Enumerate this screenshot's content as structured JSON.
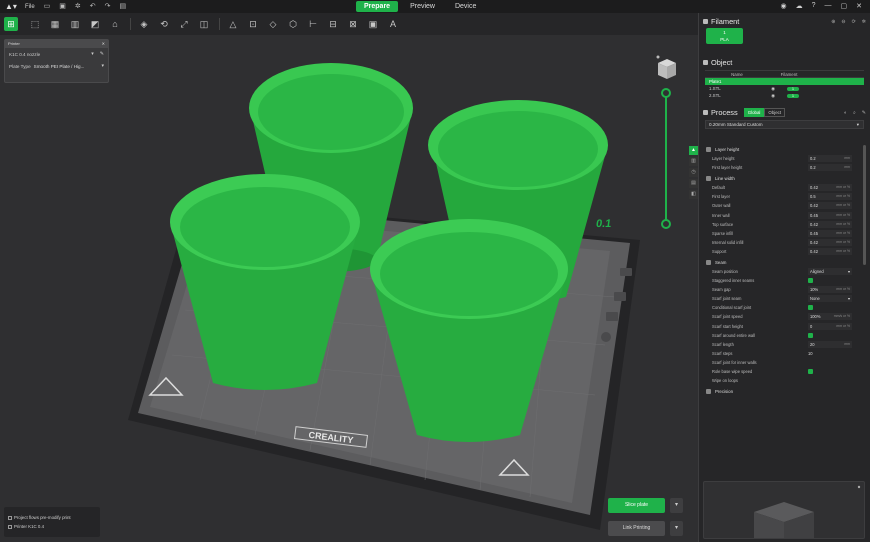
{
  "topbar": {
    "file_label": "File",
    "tabs": [
      "Prepare",
      "Preview",
      "Device"
    ],
    "active_tab": "Prepare",
    "window_controls": [
      "minimize-icon",
      "maximize-icon",
      "close-icon"
    ]
  },
  "toolbar": {
    "icons": [
      "add-plate-icon",
      "add-object-icon",
      "delete-icon",
      "arrange-icon",
      "orient-icon",
      "move-icon",
      "rotate-icon",
      "scale-icon",
      "lay-on-face-icon",
      "cut-icon",
      "mesh-boolean-icon",
      "support-paint-icon",
      "seam-paint-icon",
      "color-paint-icon",
      "measure-icon",
      "assembly-icon",
      "text-icon"
    ]
  },
  "plate_panel": {
    "title": "Printer",
    "printer": "K1C 0.4 nozzle",
    "plate_type_label": "Plate Type",
    "plate_type_value": "Smooth PEI Plate / Hig..."
  },
  "viewport": {
    "layer_value": "0.1",
    "bed_brand": "CREALITY",
    "status": [
      "Project flows pre-modify print",
      "Printer K1C 0.4"
    ],
    "slice_button": "Slice plate",
    "print_button": "Link Printing",
    "colors": {
      "accent": "#1fb24a",
      "model": "#2fc046",
      "bed": "#5a5a5c"
    }
  },
  "filament": {
    "title": "Filament",
    "slot": "1",
    "type": "PLA"
  },
  "object": {
    "title": "Object",
    "col_name": "Name",
    "col_filament": "Filament",
    "rows": [
      {
        "name": "Plate1",
        "selected": true,
        "filament": ""
      },
      {
        "name": "1.STL",
        "selected": false,
        "filament": "1"
      },
      {
        "name": "2.STL",
        "selected": false,
        "filament": "1"
      }
    ]
  },
  "process": {
    "title": "Process",
    "tab_global": "Global",
    "tab_object": "Object",
    "preset": "0.20mm Standard Custom",
    "groups": [
      {
        "name": "Layer height",
        "rows": [
          {
            "label": "Layer height",
            "value": "0.2",
            "unit": "mm"
          },
          {
            "label": "First layer height",
            "value": "0.2",
            "unit": "mm"
          }
        ]
      },
      {
        "name": "Line width",
        "rows": [
          {
            "label": "Default",
            "value": "0.42",
            "unit": "mm or %"
          },
          {
            "label": "First layer",
            "value": "0.5",
            "unit": "mm or %"
          },
          {
            "label": "Outer wall",
            "value": "0.42",
            "unit": "mm or %"
          },
          {
            "label": "Inner wall",
            "value": "0.45",
            "unit": "mm or %"
          },
          {
            "label": "Top surface",
            "value": "0.42",
            "unit": "mm or %"
          },
          {
            "label": "Sparse infill",
            "value": "0.45",
            "unit": "mm or %"
          },
          {
            "label": "Internal solid infill",
            "value": "0.42",
            "unit": "mm or %"
          },
          {
            "label": "Support",
            "value": "0.42",
            "unit": "mm or %"
          }
        ]
      },
      {
        "name": "Seam",
        "rows": [
          {
            "label": "Seam position",
            "kind": "dropdown",
            "value": "Aligned"
          },
          {
            "label": "Staggered inner seams",
            "kind": "check"
          },
          {
            "label": "Seam gap",
            "value": "10%",
            "unit": "mm or %"
          },
          {
            "label": "Scarf joint seam",
            "kind": "dropdown",
            "value": "None"
          },
          {
            "label": "Conditional scarf joint",
            "kind": "check"
          },
          {
            "label": "Scarf joint speed",
            "value": "100%",
            "unit": "mm/s or %"
          },
          {
            "label": "Scarf start height",
            "value": "0",
            "unit": "mm or %"
          },
          {
            "label": "Scarf around entire wall",
            "kind": "check"
          },
          {
            "label": "Scarf length",
            "value": "20",
            "unit": "mm"
          },
          {
            "label": "Scarf steps",
            "kind": "plain",
            "value": "10"
          },
          {
            "label": "Scarf joint for inner walls",
            "kind": "none"
          },
          {
            "label": "Role base wipe speed",
            "kind": "check"
          },
          {
            "label": "Wipe on loops",
            "kind": "none"
          }
        ]
      },
      {
        "name": "Precision",
        "rows": []
      }
    ]
  }
}
